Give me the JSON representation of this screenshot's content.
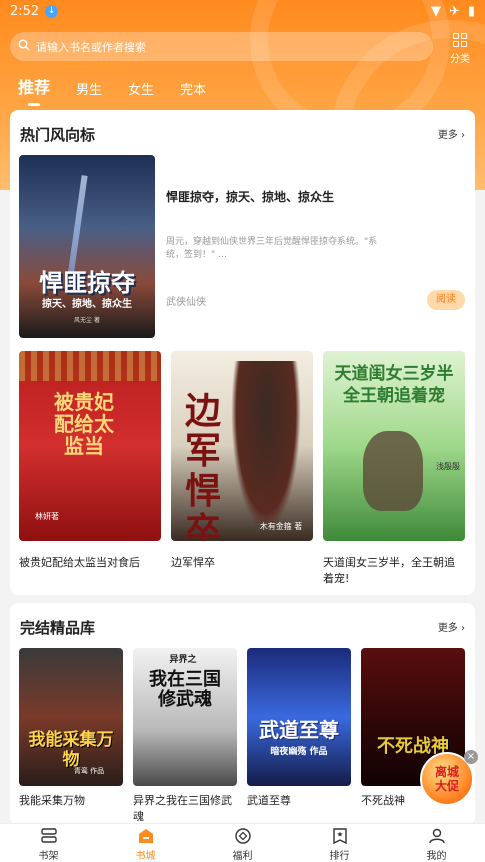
{
  "status": {
    "time": "2:52"
  },
  "search": {
    "placeholder": "请输入书名或作者搜索",
    "category_label": "分类"
  },
  "tabs": [
    {
      "label": "推荐",
      "active": true
    },
    {
      "label": "男生"
    },
    {
      "label": "女生"
    },
    {
      "label": "完本"
    }
  ],
  "hot": {
    "title": "热门风向标",
    "more": "更多",
    "featured": {
      "name": "悍匪掠夺，掠天、掠地、掠众生",
      "desc": "周元，穿越到仙侠世界三年后觉醒悍匪掠夺系统。\"系统，签到！\" …",
      "genre": "武侠仙侠",
      "read_label": "阅读",
      "cover_title": "悍匪掠夺",
      "cover_sub": "掠天、掠地、掠众生",
      "cover_author": "风无尘 著"
    },
    "books": [
      {
        "name": "被贵妃配给太监当对食后",
        "cover_title": "被贵妃配给太监当",
        "cover_author": "林妍著"
      },
      {
        "name": "边军悍卒",
        "cover_title": "边军悍卒",
        "cover_author": "木有金箍 著"
      },
      {
        "name": "天道闺女三岁半，全王朝追着宠!",
        "cover_title": "天道闺女三岁半全王朝追着宠",
        "cover_author": "浅殷殷"
      }
    ]
  },
  "complete": {
    "title": "完结精品库",
    "more": "更多",
    "books": [
      {
        "name": "我能采集万物",
        "cover_title": "我能采集万物",
        "cover_author": "青鸾 作品"
      },
      {
        "name": "异界之我在三国修武魂",
        "cover_title": "我在三国修武魂",
        "cover_author": "异界之"
      },
      {
        "name": "武道至尊",
        "cover_title": "武道至尊",
        "cover_author": "暗夜幽殇 作品"
      },
      {
        "name": "不死战神",
        "cover_title": "不死战神",
        "cover_author": ""
      }
    ]
  },
  "float_ad": {
    "line1": "离城",
    "line2": "大促"
  },
  "nav": [
    {
      "label": "书架",
      "icon": "bookshelf-icon"
    },
    {
      "label": "书城",
      "icon": "bookstore-icon",
      "active": true
    },
    {
      "label": "福利",
      "icon": "coin-icon"
    },
    {
      "label": "排行",
      "icon": "ranking-icon"
    },
    {
      "label": "我的",
      "icon": "user-icon"
    }
  ],
  "colors": {
    "accent": "#ff8a1e",
    "read_button": "#ffd9a8"
  }
}
